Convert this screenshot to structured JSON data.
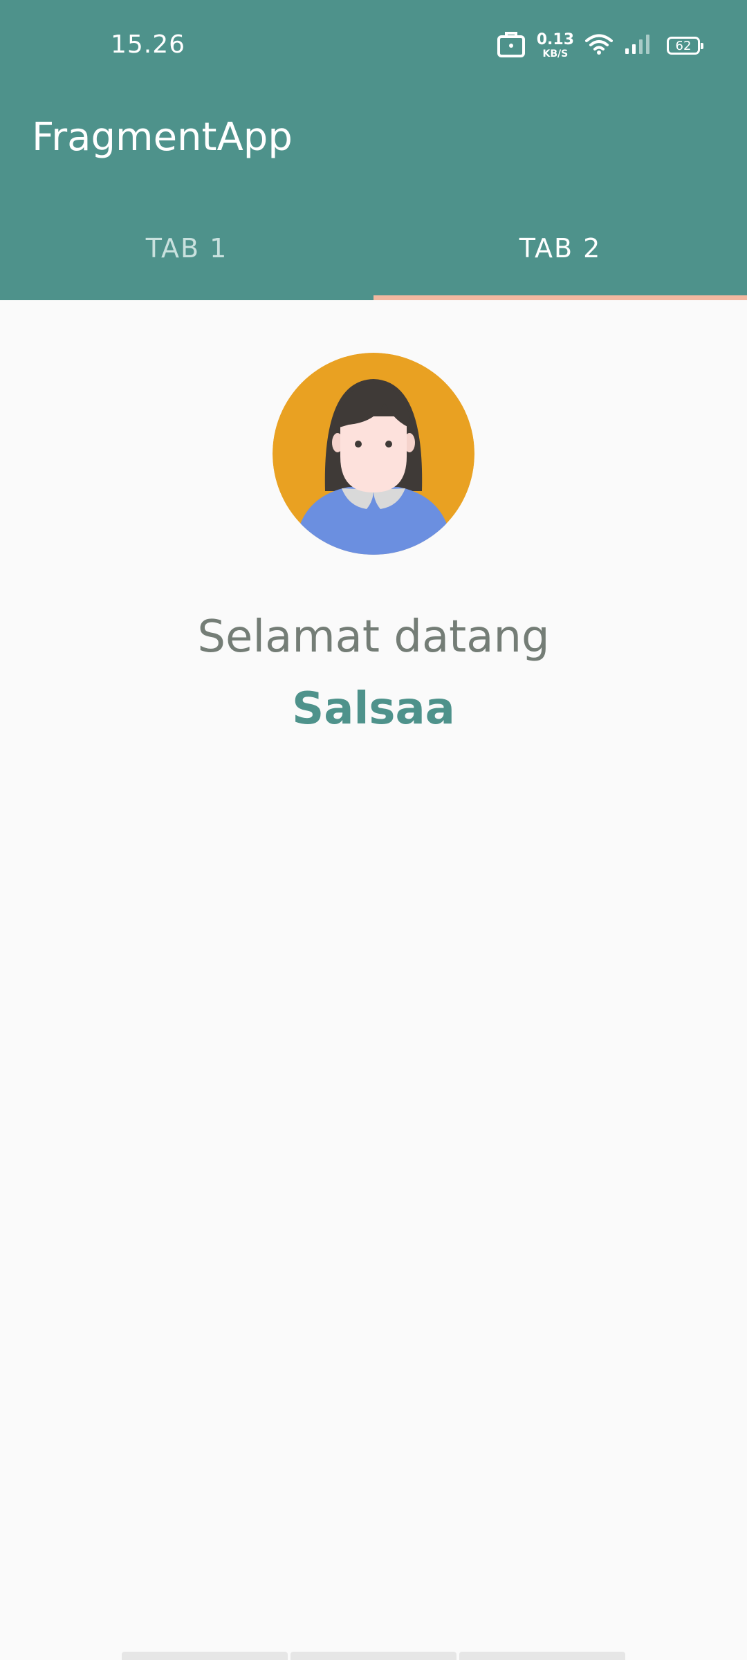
{
  "status_bar": {
    "time": "15.26",
    "net_speed_value": "0.13",
    "net_speed_unit": "KB/S",
    "battery_level": "62",
    "icons": [
      "briefcase-icon",
      "wifi-icon",
      "cellular-signal-icon",
      "battery-icon"
    ]
  },
  "app_bar": {
    "title": "FragmentApp",
    "tabs": [
      {
        "label": "TAB 1",
        "selected": false
      },
      {
        "label": "TAB 2",
        "selected": true
      }
    ]
  },
  "content": {
    "greeting": "Selamat datang",
    "username": "Salsaa",
    "avatar_icon": "user-avatar-icon"
  },
  "colors": {
    "primary": "#4e928b",
    "tab_indicator": "#f2b8a0",
    "background": "#fafafa",
    "greeting_text": "#747d76",
    "avatar_bg": "#e9a122",
    "avatar_shirt": "#6b8fe0"
  }
}
